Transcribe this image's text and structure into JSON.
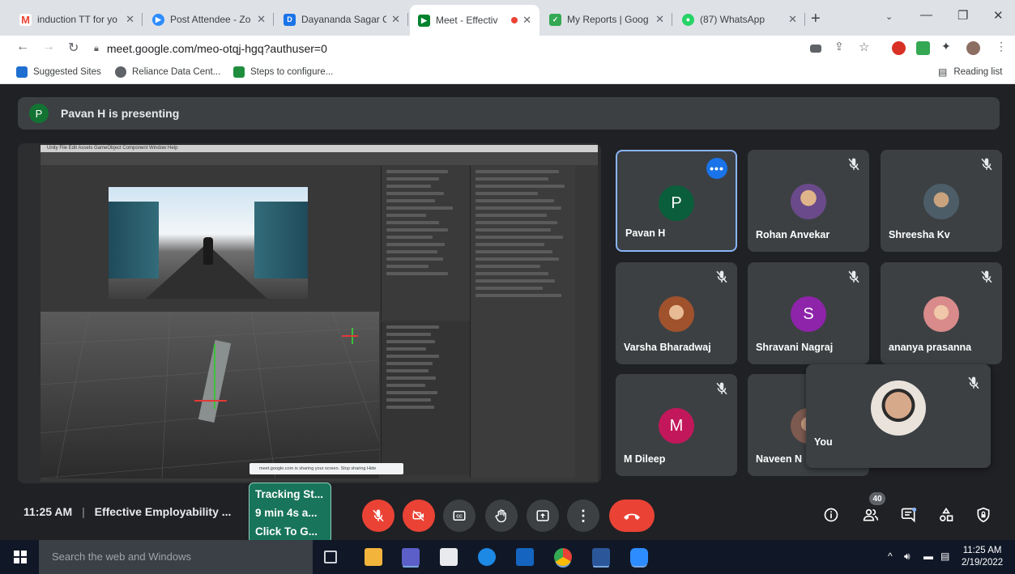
{
  "browser": {
    "tabs": [
      {
        "title": "induction TT for yo",
        "icon": "gmail-icon",
        "color": "#ea4335",
        "active": false
      },
      {
        "title": "Post Attendee - Zo",
        "icon": "zoom-icon",
        "color": "#2d8cff",
        "active": false
      },
      {
        "title": "Dayananda Sagar C",
        "icon": "dsu-icon",
        "color": "#1a73e8",
        "active": false
      },
      {
        "title": "Meet - Effectiv",
        "icon": "meet-icon",
        "color": "#00832d",
        "active": true
      },
      {
        "title": "My Reports | Goog",
        "icon": "reports-icon",
        "color": "#34a853",
        "active": false
      },
      {
        "title": "(87) WhatsApp",
        "icon": "whatsapp-icon",
        "color": "#25d366",
        "active": false
      }
    ],
    "close_glyph": "✕",
    "new_tab_glyph": "+",
    "url": "meet.google.com/meo-otqj-hgq?authuser=0",
    "bookmarks": [
      {
        "label": "Suggested Sites",
        "color": "#1f6fd1"
      },
      {
        "label": "Reliance Data Cent...",
        "color": "#5f6368"
      },
      {
        "label": "Steps to configure...",
        "color": "#1e8e3e"
      }
    ],
    "reading_list": "Reading list"
  },
  "meet": {
    "presenter_initial": "P",
    "presenting_text": "Pavan H is presenting",
    "sharing_banner": "meet.google.com is sharing your screen.   Stop sharing    Hide",
    "unity_menu": "Unity  File  Edit  Assets  GameObject  Component  Window  Help",
    "participants": [
      {
        "name": "Pavan H",
        "initial": "P",
        "avatar_color": "#0b5e3b",
        "muted": false,
        "active": true,
        "photo": false
      },
      {
        "name": "Rohan Anvekar",
        "initial": "",
        "avatar_color": "#8a6d3b",
        "muted": true,
        "active": false,
        "photo": true
      },
      {
        "name": "Shreesha Kv",
        "initial": "",
        "avatar_color": "#556b7a",
        "muted": true,
        "active": false,
        "photo": true
      },
      {
        "name": "Varsha Bharadwaj",
        "initial": "",
        "avatar_color": "#b5651d",
        "muted": true,
        "active": false,
        "photo": true
      },
      {
        "name": "Shravani Nagraj",
        "initial": "S",
        "avatar_color": "#8e24aa",
        "muted": true,
        "active": false,
        "photo": false
      },
      {
        "name": "ananya prasanna",
        "initial": "",
        "avatar_color": "#c07a7a",
        "muted": true,
        "active": false,
        "photo": true
      },
      {
        "name": "M Dileep",
        "initial": "M",
        "avatar_color": "#c2185b",
        "muted": true,
        "active": false,
        "photo": false
      },
      {
        "name": "Naveen N",
        "initial": "",
        "avatar_color": "#7d5a4f",
        "muted": false,
        "active": false,
        "photo": true
      }
    ],
    "you_label": "You",
    "time": "11:25 AM",
    "separator": "|",
    "meeting_title": "Effective Employability ...",
    "tracking_lines": [
      "Tracking St...",
      "9 min 4s a...",
      "Click To G..."
    ],
    "people_count": "40",
    "more_glyph": "•••"
  },
  "taskbar": {
    "search_placeholder": "Search the web and Windows",
    "clock_time": "11:25 AM",
    "clock_date": "2/19/2022",
    "tray_chevron": "^"
  }
}
